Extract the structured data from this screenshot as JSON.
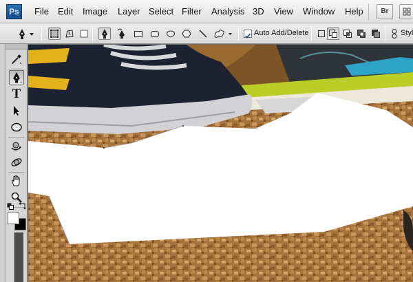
{
  "app": {
    "logo": "Ps",
    "menu": [
      "File",
      "Edit",
      "Image",
      "Layer",
      "Select",
      "Filter",
      "Analysis",
      "3D",
      "View",
      "Window",
      "Help"
    ],
    "bridge_button": "Br"
  },
  "options_bar": {
    "auto_add_delete_label": "Auto Add/Delete",
    "auto_add_delete_checked": true,
    "style_label": "Styl"
  },
  "tools": {
    "active_tool": "pen-tool",
    "type_tool_glyph": "T",
    "foreground_color": "#000000",
    "background_color": "#ffffff"
  },
  "canvas": {
    "content": "sneakers on cork board with white path shape"
  }
}
